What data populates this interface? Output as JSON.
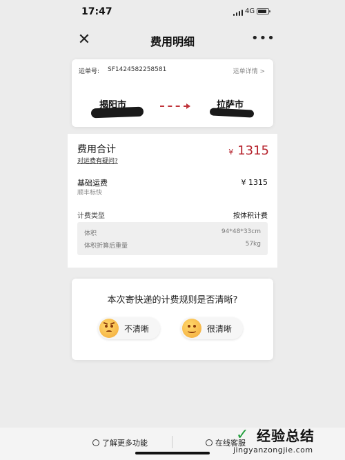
{
  "status_bar": {
    "time": "17:47",
    "network": "4G",
    "battery_level": 0.85
  },
  "nav": {
    "title": "费用明细",
    "close_icon": "close-icon",
    "more_icon": "more-icon"
  },
  "waybill": {
    "label": "运单号:",
    "number": "SF1424582258581",
    "detail_link": "运单详情 >",
    "from_city": "揭阳市",
    "to_city": "拉萨市"
  },
  "fees": {
    "total_label": "费用合计",
    "question_link": "对运费有疑问?",
    "total_currency": "¥",
    "total_amount": "1315",
    "basic_label": "基础运费",
    "basic_service": "顺丰标快",
    "basic_amount": "¥ 1315",
    "type_label": "计费类型",
    "type_value": "按体积计费",
    "volume_label": "体积",
    "volume_value": "94*48*33cm",
    "weight_label": "体积折算后重量",
    "weight_value": "57kg",
    "accent_color": "#b5202a"
  },
  "survey": {
    "question": "本次寄快递的计费规则是否清晰?",
    "unclear_label": "不清晰",
    "clear_label": "很清晰"
  },
  "bottom_bar": {
    "more_label": "了解更多功能",
    "service_label": "在线客服"
  },
  "watermark": {
    "main": "经验总结",
    "sub": "jingyanzongjie.com"
  }
}
